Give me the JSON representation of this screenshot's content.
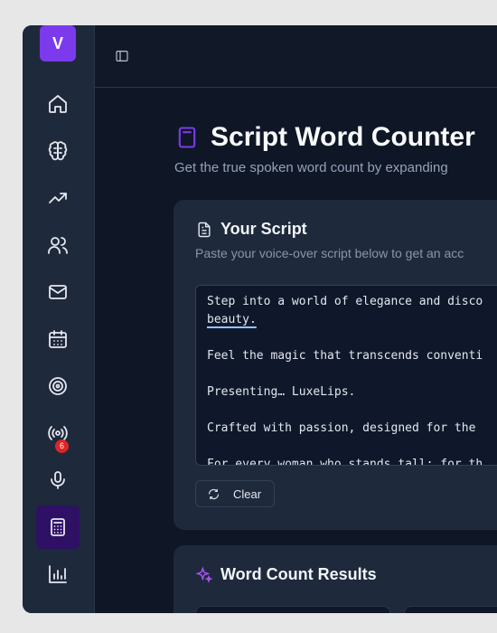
{
  "sidebar": {
    "logo_letter": "V",
    "items": [
      {
        "icon": "home-icon"
      },
      {
        "icon": "brain-icon"
      },
      {
        "icon": "trending-up-icon"
      },
      {
        "icon": "users-icon"
      },
      {
        "icon": "mail-icon"
      },
      {
        "icon": "calendar-icon"
      },
      {
        "icon": "target-icon"
      },
      {
        "icon": "broadcast-icon",
        "badge": "6"
      },
      {
        "icon": "microphone-icon"
      },
      {
        "icon": "calculator-icon",
        "active": true
      },
      {
        "icon": "bar-chart-icon"
      }
    ]
  },
  "page": {
    "title": "Script Word Counter",
    "subtitle": "Get the true spoken word count by expanding"
  },
  "script_card": {
    "title": "Your Script",
    "description": "Paste your voice-over script below to get an acc",
    "lines": [
      "Step into a world of elegance and disco",
      "beauty.",
      "Feel the magic that transcends conventi",
      "Presenting… LuxeLips.",
      "Crafted with passion, designed for the",
      "For every woman who stands tall; for th"
    ],
    "clear_label": "Clear"
  },
  "results_card": {
    "title": "Word Count Results"
  },
  "colors": {
    "accent": "#7c3aed",
    "badge": "#dc2626"
  }
}
